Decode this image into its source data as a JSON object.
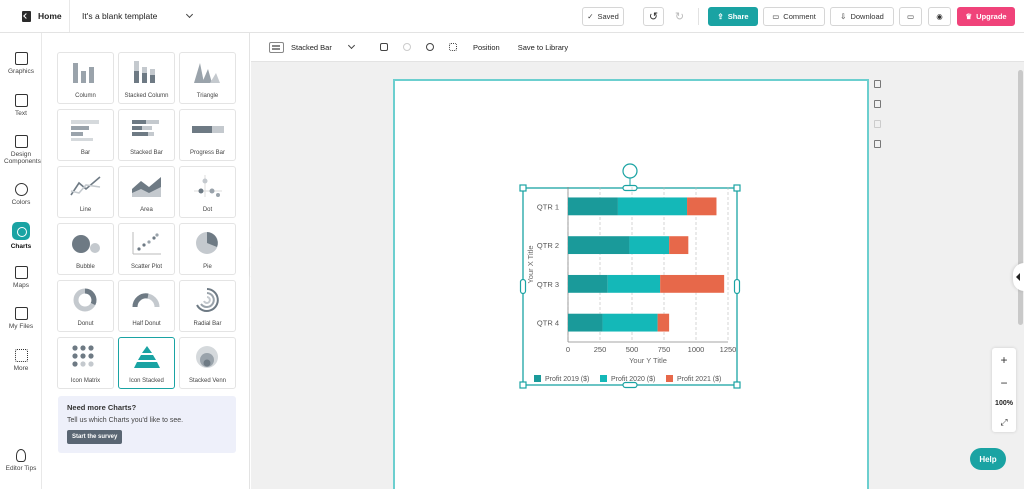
{
  "topbar": {
    "home_label": "Home",
    "doc_title": "It's a blank template",
    "saved_label": "Saved",
    "share_label": "Share",
    "comment_label": "Comment",
    "download_label": "Download",
    "upgrade_label": "Upgrade",
    "colors": {
      "share": "#1aa3a3",
      "upgrade": "#f0437a"
    }
  },
  "rail": {
    "items": [
      {
        "label": "Graphics",
        "icon": "graphics-icon"
      },
      {
        "label": "Text",
        "icon": "text-icon"
      },
      {
        "label": "Design Components",
        "icon": "design-components-icon"
      },
      {
        "label": "Colors",
        "icon": "palette-icon"
      },
      {
        "label": "Charts",
        "icon": "charts-icon",
        "active": true
      },
      {
        "label": "Maps",
        "icon": "map-icon"
      },
      {
        "label": "My Files",
        "icon": "folder-icon"
      },
      {
        "label": "More",
        "icon": "grid-icon"
      }
    ],
    "editor_tips_label": "Editor Tips"
  },
  "panel": {
    "tiles": [
      {
        "label": "Column"
      },
      {
        "label": "Stacked Column"
      },
      {
        "label": "Triangle"
      },
      {
        "label": "Bar"
      },
      {
        "label": "Stacked Bar"
      },
      {
        "label": "Progress Bar"
      },
      {
        "label": "Line"
      },
      {
        "label": "Area"
      },
      {
        "label": "Dot"
      },
      {
        "label": "Bubble"
      },
      {
        "label": "Scatter Plot"
      },
      {
        "label": "Pie"
      },
      {
        "label": "Donut"
      },
      {
        "label": "Half Donut"
      },
      {
        "label": "Radial Bar"
      },
      {
        "label": "Icon Matrix"
      },
      {
        "label": "Icon Stacked",
        "selected": true
      },
      {
        "label": "Stacked Venn"
      }
    ],
    "promo": {
      "title": "Need more Charts?",
      "text": "Tell us which Charts you'd like to see.",
      "button": "Start the survey"
    }
  },
  "context_toolbar": {
    "chart_type": "Stacked Bar",
    "position_label": "Position",
    "save_label": "Save to Library"
  },
  "zoom": {
    "plus": "+",
    "minus": "−",
    "percent": "100%"
  },
  "help_label": "Help",
  "chart_data": {
    "type": "bar",
    "orientation": "horizontal",
    "stacked": true,
    "categories": [
      "QTR 1",
      "QTR 2",
      "QTR 3",
      "QTR 4"
    ],
    "series": [
      {
        "name": "Profit 2019 ($)",
        "values": [
          390,
          480,
          310,
          270
        ],
        "color": "#1a9a9a"
      },
      {
        "name": "Profit 2020 ($)",
        "values": [
          540,
          310,
          410,
          430
        ],
        "color": "#14b8b8"
      },
      {
        "name": "Profit 2021 ($)",
        "values": [
          230,
          150,
          500,
          90
        ],
        "color": "#e7684a"
      }
    ],
    "xlabel": "Your Y Title",
    "ylabel": "Your X Title",
    "xlim": [
      0,
      1250
    ],
    "xticks": [
      "0",
      "250",
      "500",
      "750",
      "1000",
      "1250"
    ],
    "grid": "vertical dashed",
    "legend": "bottom"
  }
}
